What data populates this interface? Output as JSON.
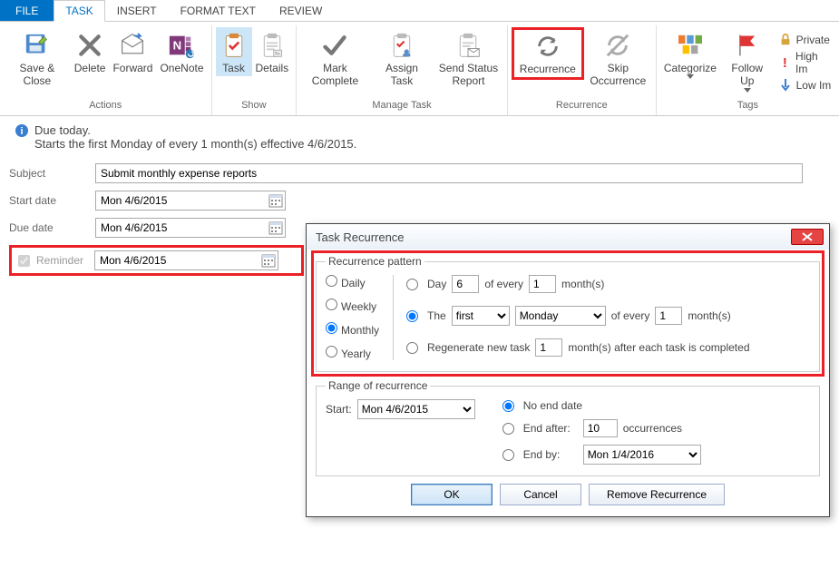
{
  "tabs": {
    "file": "FILE",
    "task": "TASK",
    "insert": "INSERT",
    "format": "FORMAT TEXT",
    "review": "REVIEW"
  },
  "groups": {
    "actions": "Actions",
    "show": "Show",
    "manage": "Manage Task",
    "recurrence": "Recurrence",
    "tags": "Tags"
  },
  "ribbon": {
    "save": "Save & Close",
    "delete": "Delete",
    "forward": "Forward",
    "onenote": "OneNote",
    "task": "Task",
    "details": "Details",
    "mark": "Mark Complete",
    "assign": "Assign Task",
    "sendstatus": "Send Status Report",
    "recurrence": "Recurrence",
    "skip": "Skip Occurrence",
    "categorize": "Categorize",
    "followup": "Follow Up",
    "private": "Private",
    "highimp": "High Im",
    "lowimp": "Low Im"
  },
  "info": {
    "line1": "Due today.",
    "line2": "Starts the first Monday of every 1 month(s) effective 4/6/2015."
  },
  "labels": {
    "subject": "Subject",
    "start": "Start date",
    "due": "Due date",
    "reminder": "Reminder"
  },
  "values": {
    "subject": "Submit monthly expense reports",
    "start": "Mon 4/6/2015",
    "due": "Mon 4/6/2015",
    "reminder": "Mon 4/6/2015"
  },
  "dialog": {
    "title": "Task Recurrence",
    "legend1": "Recurrence pattern",
    "legend2": "Range of recurrence",
    "freq": {
      "daily": "Daily",
      "weekly": "Weekly",
      "monthly": "Monthly",
      "yearly": "Yearly"
    },
    "opt": {
      "day": "Day",
      "dayval": "6",
      "ofevery": "of every",
      "everyval": "1",
      "months": "month(s)",
      "the": "The",
      "ord": "first",
      "dow": "Monday",
      "ofevery2": "of every",
      "everyval2": "1",
      "months2": "month(s)",
      "regen": "Regenerate new task",
      "regenval": "1",
      "regensuffix": "month(s) after each task is completed"
    },
    "range": {
      "startlbl": "Start:",
      "startval": "Mon 4/6/2015",
      "noend": "No end date",
      "endafter": "End after:",
      "endafterval": "10",
      "occ": "occurrences",
      "endby": "End by:",
      "endbyval": "Mon 1/4/2016"
    },
    "buttons": {
      "ok": "OK",
      "cancel": "Cancel",
      "remove": "Remove Recurrence"
    }
  }
}
